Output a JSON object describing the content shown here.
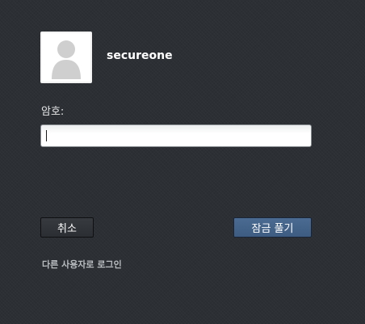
{
  "user": {
    "username": "secureone",
    "avatar_icon": "user-silhouette-icon"
  },
  "password": {
    "label": "암호:",
    "value": ""
  },
  "buttons": {
    "cancel_label": "취소",
    "unlock_label": "잠금 풀기"
  },
  "links": {
    "switch_user_label": "다른 사용자로 로그인"
  },
  "colors": {
    "background": "#2c3035",
    "unlock_button": "#45648a",
    "cancel_button": "#33373b",
    "link_text": "#b9bcbf"
  }
}
